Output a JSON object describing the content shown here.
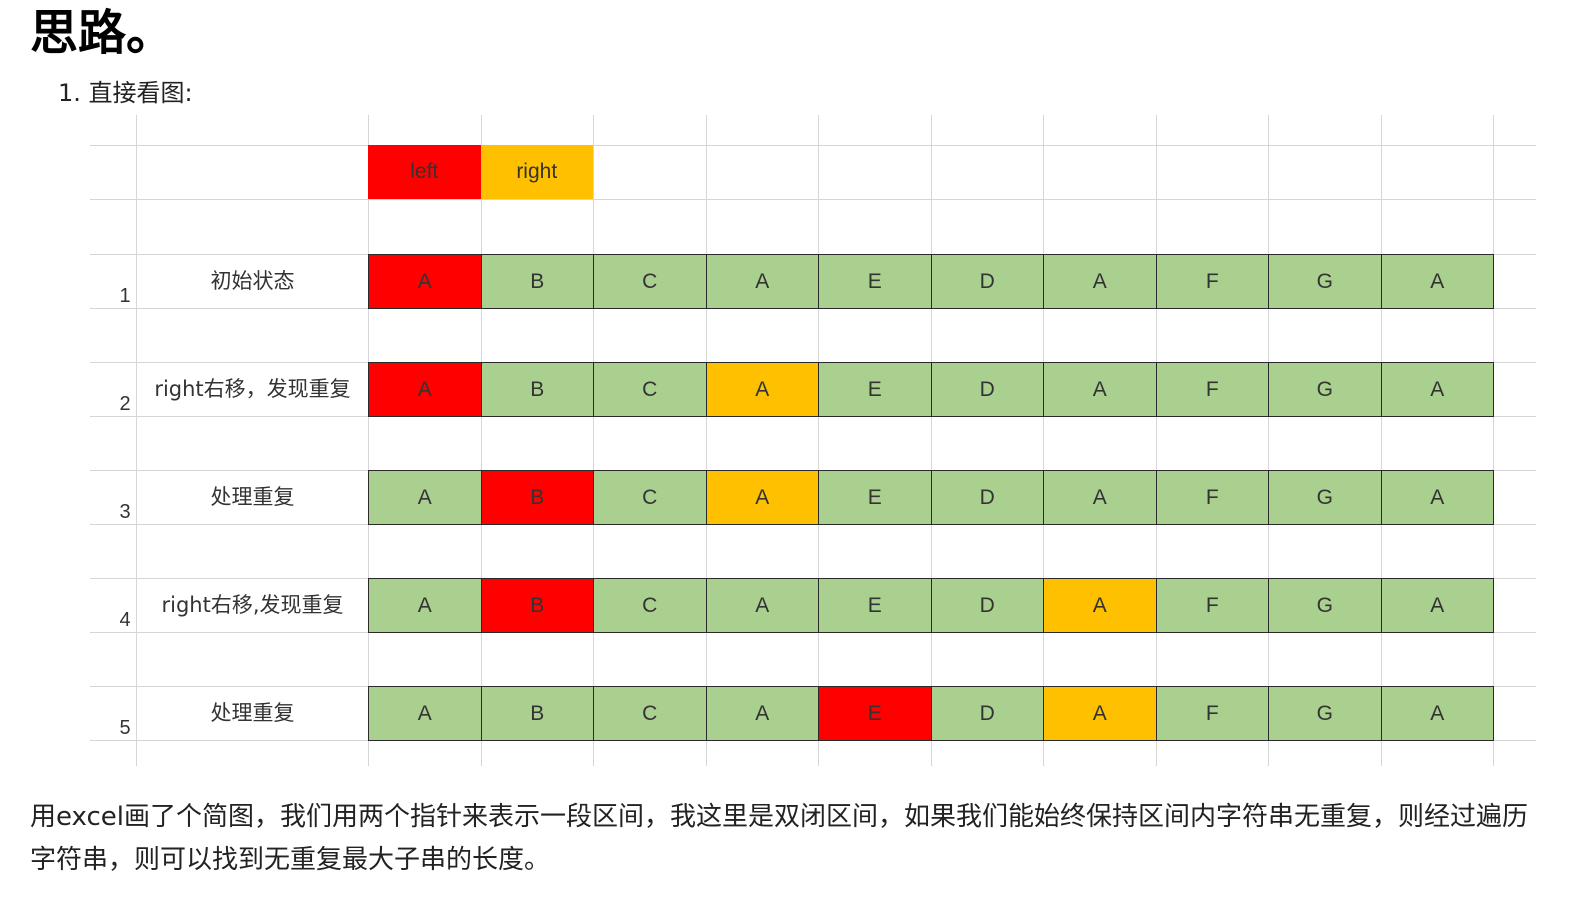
{
  "heading": "思路。",
  "list_item": {
    "number": "1.",
    "text": "直接看图:"
  },
  "figure": {
    "legend": [
      {
        "label": "left",
        "color": "#ff0000"
      },
      {
        "label": "right",
        "color": "#ffc000"
      }
    ],
    "colors": {
      "cell": "#a9d08e",
      "left": "#ff0000",
      "right": "#ffc000",
      "gridline": "#d6d6d6",
      "border": "#2a2a2a"
    },
    "rows": [
      {
        "number": "1",
        "label": "初始状态",
        "cells": [
          "A",
          "B",
          "C",
          "A",
          "E",
          "D",
          "A",
          "F",
          "G",
          "A"
        ],
        "left_index": 0,
        "right_index": 0
      },
      {
        "number": "2",
        "label": "right右移，发现重复",
        "cells": [
          "A",
          "B",
          "C",
          "A",
          "E",
          "D",
          "A",
          "F",
          "G",
          "A"
        ],
        "left_index": 0,
        "right_index": 3
      },
      {
        "number": "3",
        "label": "处理重复",
        "cells": [
          "A",
          "B",
          "C",
          "A",
          "E",
          "D",
          "A",
          "F",
          "G",
          "A"
        ],
        "left_index": 1,
        "right_index": 3
      },
      {
        "number": "4",
        "label": "right右移,发现重复",
        "cells": [
          "A",
          "B",
          "C",
          "A",
          "E",
          "D",
          "A",
          "F",
          "G",
          "A"
        ],
        "left_index": 1,
        "right_index": 6
      },
      {
        "number": "5",
        "label": "处理重复",
        "cells": [
          "A",
          "B",
          "C",
          "A",
          "E",
          "D",
          "A",
          "F",
          "G",
          "A"
        ],
        "left_index": 4,
        "right_index": 6
      }
    ]
  },
  "paragraph": "用excel画了个简图，我们用两个指针来表示一段区间，我这里是双闭区间，如果我们能始终保持区间内字符串无重复，则经过遍历字符串，则可以找到无重复最大子串的长度。"
}
